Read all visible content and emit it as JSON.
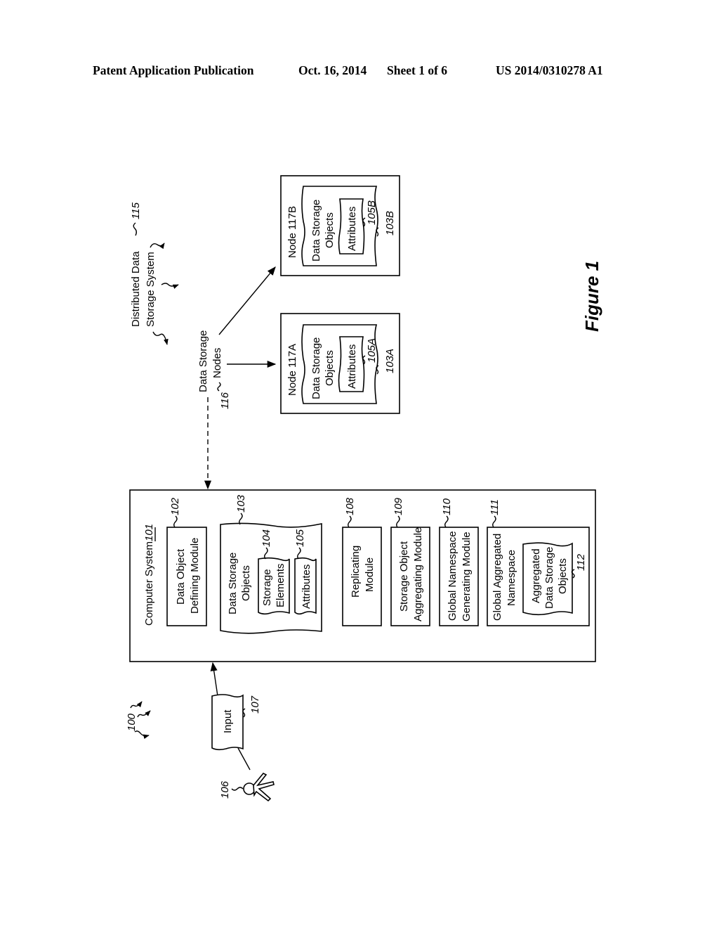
{
  "header": {
    "publication": "Patent Application Publication",
    "date": "Oct. 16, 2014",
    "sheet": "Sheet 1 of 6",
    "number": "US 2014/0310278 A1"
  },
  "figure": {
    "title": "Figure 1",
    "system_ref": "100",
    "distributed_system": {
      "label_line1": "Distributed Data",
      "label_line2": "Storage System",
      "ref": "115"
    },
    "data_storage_nodes": {
      "label_line1": "Data Storage",
      "label_line2": "Nodes",
      "ref": "116"
    },
    "nodes": [
      {
        "title": "Node 117A",
        "objects_line1": "Data Storage",
        "objects_line2": "Objects",
        "objects_ref": "103A",
        "attributes_label": "Attributes",
        "attributes_ref": "105A"
      },
      {
        "title": "Node 117B",
        "objects_line1": "Data Storage",
        "objects_line2": "Objects",
        "objects_ref": "103B",
        "attributes_label": "Attributes",
        "attributes_ref": "105B"
      }
    ],
    "computer_system": {
      "label": "Computer System",
      "ref": "101",
      "modules": {
        "data_object_defining": {
          "line1": "Data Object",
          "line2": "Defining Module",
          "ref": "102"
        },
        "data_storage_objects": {
          "line1": "Data Storage",
          "line2": "Objects",
          "ref": "103"
        },
        "storage_elements": {
          "line1": "Storage",
          "line2": "Elements",
          "ref": "104"
        },
        "attributes": {
          "line1": "Attributes",
          "ref": "105"
        },
        "replicating": {
          "line1": "Replicating",
          "line2": "Module",
          "ref": "108"
        },
        "storage_object_aggregating": {
          "line1": "Storage Object",
          "line2": "Aggregating Module",
          "ref": "109"
        },
        "global_namespace_generating": {
          "line1": "Global Namespace",
          "line2": "Generating Module",
          "ref": "110"
        },
        "global_aggregated_namespace": {
          "line1": "Global Aggregated",
          "line2": "Namespace",
          "ref": "111"
        },
        "aggregated_objects": {
          "line1": "Aggregated",
          "line2": "Data Storage",
          "line3": "Objects",
          "ref": "112"
        }
      }
    },
    "input": {
      "label": "Input",
      "ref": "107"
    },
    "user": {
      "ref": "106"
    }
  }
}
